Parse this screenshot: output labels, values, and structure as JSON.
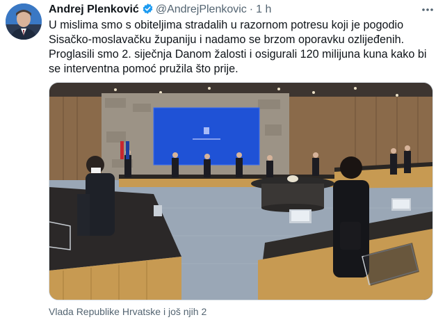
{
  "tweet": {
    "author_name": "Andrej Plenković",
    "handle": "@AndrejPlenkovic",
    "separator": "·",
    "time": "1 h",
    "text_lines": [
      "U mislima smo s obiteljima stradalih u razornom potresu koji je pogodio",
      "Sisačko-moslavačku županiju i nadamo se brzom oporavku ozlijeđenih.",
      "Proglasili smo 2. siječnja Danom žalosti i osigurali 120 milijuna kuna kako bi",
      "se interventna pomoć pružila što prije."
    ],
    "media_caption": "Vlada Republike Hrvatske i još njih 2"
  },
  "icons": {
    "verified": "verified-badge-icon",
    "more": "more-options-icon"
  },
  "colors": {
    "verified_badge": "#1d9bf0",
    "secondary_text": "#536471",
    "primary_text": "#0f1419",
    "screen_blue": "#1f52d6"
  }
}
